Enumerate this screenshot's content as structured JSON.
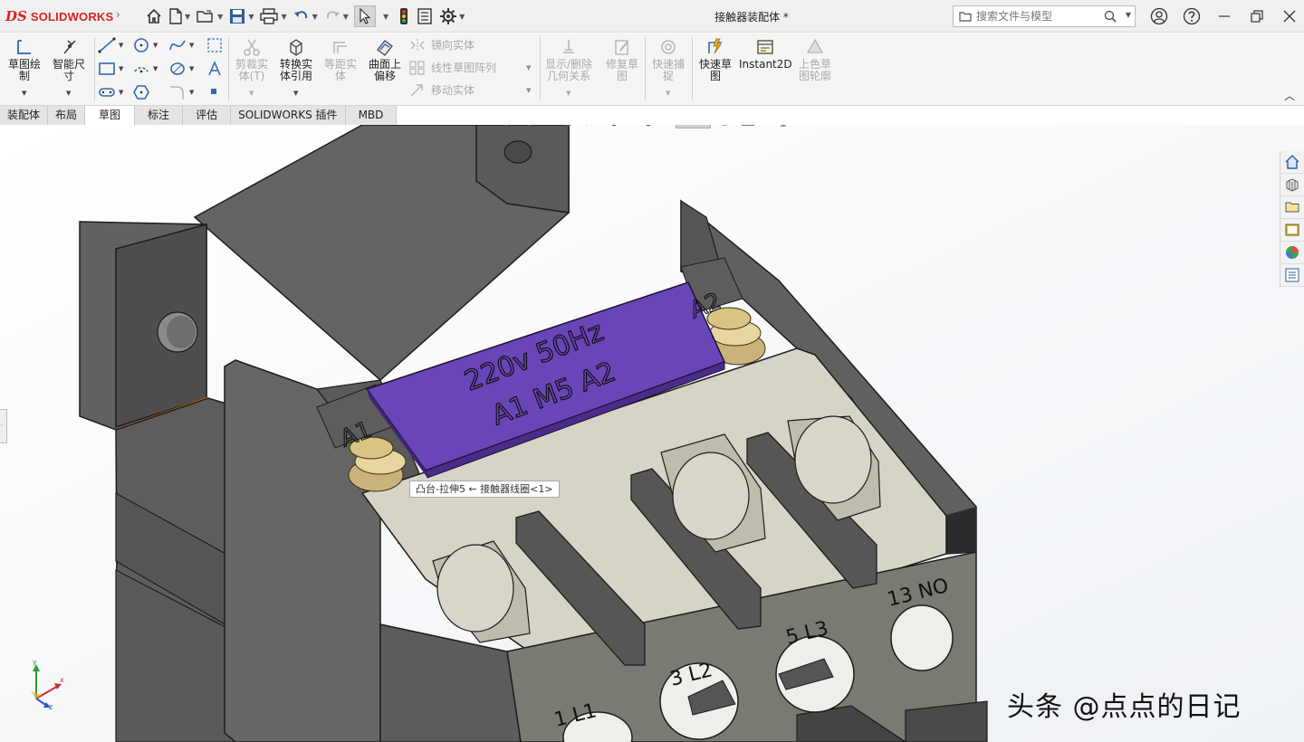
{
  "app": {
    "brand": "SOLIDWORKS",
    "brand_mark": "DS",
    "document_title": "接触器装配体 *"
  },
  "search": {
    "placeholder": "搜索文件与模型"
  },
  "ribbon": {
    "sketch": "草图绘\n制",
    "smart_dim": "智能尺\n寸",
    "trim": "剪裁实\n体(T)",
    "convert": "转换实\n体引用",
    "offset": "等距实\n体",
    "surface_offset": "曲面上\n偏移",
    "mirror": "镜向实体",
    "linear_pattern": "线性草图阵列",
    "move": "移动实体",
    "show_relations": "显示/删除\n几何关系",
    "repair": "修复草\n图",
    "quick_snap": "快速捕\n捉",
    "rapid_sketch": "快速草\n图",
    "instant2d": "Instant2D",
    "shaded_contours": "上色草\n图轮廓"
  },
  "tabs": [
    "装配体",
    "布局",
    "草图",
    "标注",
    "评估",
    "SOLIDWORKS 插件",
    "MBD"
  ],
  "active_tab": "草图",
  "model": {
    "coil_line1": "220v 50Hz",
    "coil_line2": "A1 M5 A2",
    "terminal_a1": "A1",
    "terminal_a2": "A2",
    "label_1l1": "1 L1",
    "label_3l2": "3 L2",
    "label_5l3": "5 L3",
    "label_13no": "13 NO"
  },
  "tooltip": "凸台-拉伸5 ← 接触器线圈<1>",
  "triad": {
    "x": "x",
    "y": "y",
    "z": "z"
  },
  "watermark": "头条 @点点的日记",
  "colors": {
    "accent_red": "#d8231f",
    "coil_purple": "#6a45b8",
    "housing_gray": "#5a5a5a",
    "insert_beige": "#d6d4c6",
    "edge_orange": "#ff7a00"
  }
}
